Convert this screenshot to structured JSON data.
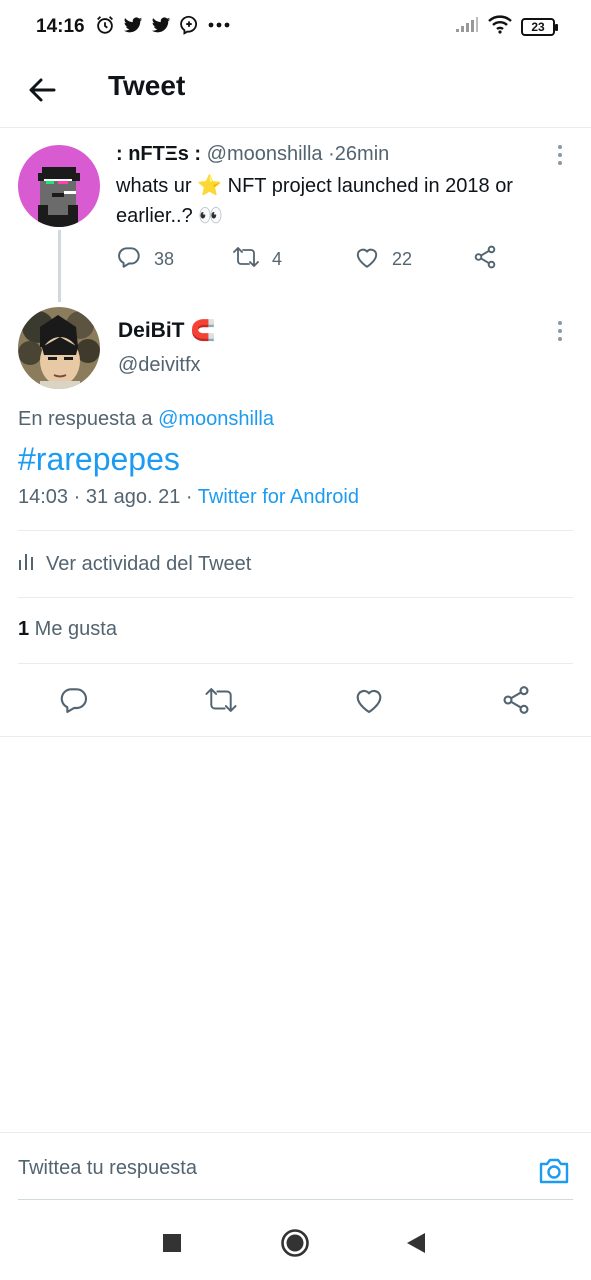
{
  "status_bar": {
    "time": "14:16",
    "battery": "23",
    "left_icons": [
      "alarm-icon",
      "twitter-bird-icon",
      "twitter-bird-icon",
      "messenger-icon",
      "more-dots-icon"
    ],
    "right_icons": [
      "signal-icon",
      "wifi-icon",
      "battery-icon"
    ]
  },
  "header": {
    "title": "Tweet"
  },
  "parent_tweet": {
    "display_name": ": nFTΞs :",
    "handle": "@moonshilla",
    "separator": "·",
    "time": "26min",
    "text_before": "whats ur ",
    "star_emoji": "⭐",
    "text_after": " NFT project launched in 2018 or earlier..? ",
    "eyes_emoji": "👀",
    "replies": "38",
    "retweets": "4",
    "likes": "22"
  },
  "main_tweet": {
    "display_name": "DeiBiT",
    "name_emoji": "🧲",
    "handle": "@deivitfx",
    "reply_prefix": "En respuesta a ",
    "reply_handle": "@moonshilla",
    "text": "#rarepepes",
    "timestamp": "14:03 · 31 ago. 21 · ",
    "source": "Twitter for Android",
    "activity_label": "Ver actividad del Tweet",
    "likes_count": "1",
    "likes_label": " Me gusta"
  },
  "reply_bar": {
    "placeholder": "Twittea tu respuesta"
  },
  "colors": {
    "accent": "#1d9bf0",
    "text": "#0f1419",
    "muted": "#536471",
    "divider": "#e6ecf0"
  }
}
